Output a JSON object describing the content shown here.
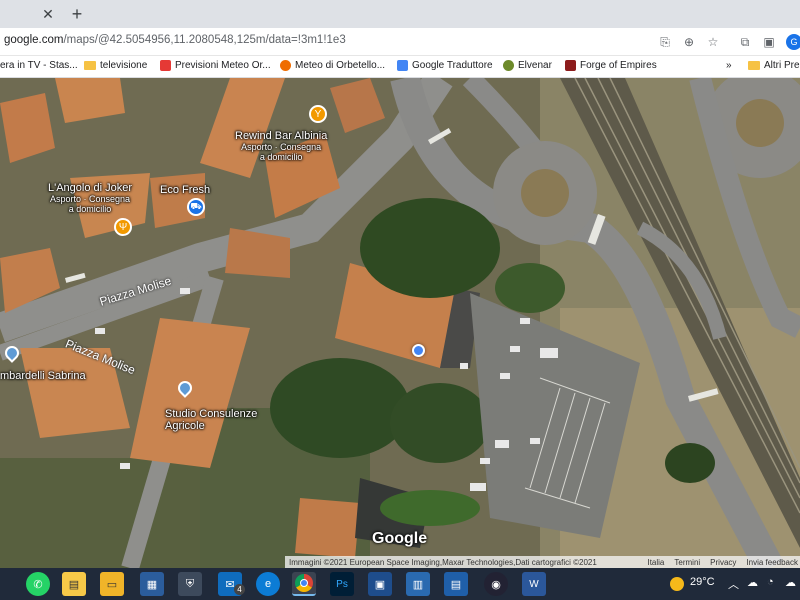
{
  "browser": {
    "tab_close_icon": "close-icon",
    "new_tab_icon": "plus-icon",
    "url_host": "google.com",
    "url_path": "/maps/@42.5054956,11.2080548,125m/data=!3m1!1e3",
    "profile_initial": "G"
  },
  "bookmarks": [
    {
      "label": "era in TV - Stas...",
      "icon_color": "#c62828"
    },
    {
      "label": "televisione",
      "icon": "folder"
    },
    {
      "label": "Previsioni Meteo Or...",
      "icon_color": "#e53935"
    },
    {
      "label": "Meteo di Orbetello...",
      "icon_color": "#ef6c00"
    },
    {
      "label": "Google Traduttore",
      "icon_color": "#4285f4"
    },
    {
      "label": "Elvenar",
      "icon_color": "#6d8a2a"
    },
    {
      "label": "Forge of Empires",
      "icon_color": "#8d1c1c"
    }
  ],
  "bookmarks_more": "»",
  "bookmarks_other": "Altri Pre",
  "map": {
    "places": [
      {
        "name": "Rewind Bar Albinia",
        "sub1": "Asporto · Consegna",
        "sub2": "a domicilio",
        "icon": "bar-icon"
      },
      {
        "name": "L'Angolo di Joker",
        "sub1": "Asporto · Consegna",
        "sub2": "a domicilio",
        "icon": "restaurant-icon"
      },
      {
        "name": "Eco Fresh",
        "icon": "shopping-cart-icon"
      },
      {
        "name": "Studio Consulenze",
        "name2": "Agricole",
        "icon": "place-pin-icon"
      },
      {
        "name": "mbardelli Sabrina",
        "icon": "place-pin-icon"
      }
    ],
    "roads": [
      "Piazza Molise",
      "Piazza Molise"
    ],
    "logo": "Google",
    "footer": {
      "attribution": "Immagini ©2021 European Space Imaging,Maxar Technologies,Dati cartografici ©2021",
      "country": "Italia",
      "terms": "Termini",
      "privacy": "Privacy",
      "feedback": "Invia feedback"
    }
  },
  "taskbar": {
    "mail_badge": "4",
    "temperature": "29°C"
  }
}
